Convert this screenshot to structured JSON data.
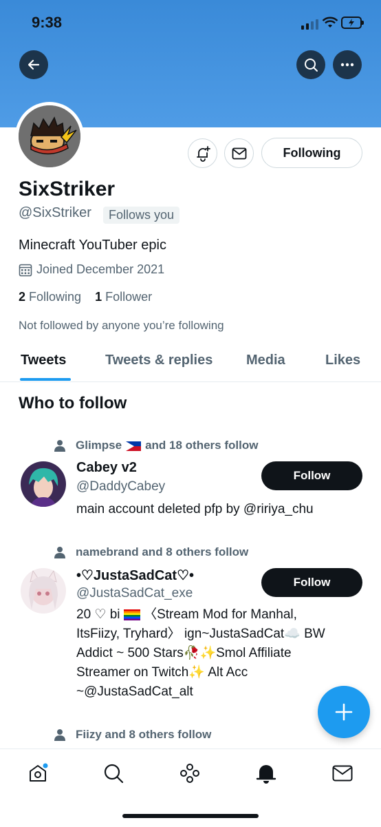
{
  "status_bar": {
    "time": "9:38"
  },
  "profile": {
    "name": "SixStriker",
    "handle": "@SixStriker",
    "follows_you": "Follows you",
    "bio": "Minecraft YouTuber epic",
    "joined": "Joined December 2021",
    "following_count": "2",
    "following_label": "Following",
    "follower_count": "1",
    "follower_label": "Follower",
    "not_followed": "Not followed by anyone you’re following",
    "following_button": "Following"
  },
  "tabs": [
    "Tweets",
    "Tweets & replies",
    "Media",
    "Likes"
  ],
  "who_to_follow": {
    "title": "Who to follow",
    "users": [
      {
        "social_context_pre": "Glimpse",
        "social_context_post": "and 18 others follow",
        "name": "Cabey v2",
        "handle": "@DaddyCabey",
        "bio": "main account deleted pfp by @ririya_chu",
        "button": "Follow"
      },
      {
        "social_context": "namebrand and 8 others follow",
        "name": "•♡JustaSadCat♡•",
        "handle": "@JustaSadCat_exe",
        "bio_line1_pre": "20 ♡ bi",
        "bio_line1_post": "〈Stream Mod for Manhal,",
        "bio_line2": "ItsFiizy, Tryhard〉 ign~JustaSadCat☁️ BW",
        "bio_line3": "Addict ~ 500 Stars🥀✨Smol Affiliate",
        "bio_line4": "Streamer on Twitch✨ Alt Acc",
        "bio_line5": "~@JustaSadCat_alt",
        "button": "Follow"
      },
      {
        "social_context": "Fiizy and 8 others follow"
      }
    ]
  },
  "colors": {
    "accent": "#1d9bf0",
    "banner": "#4a96e2",
    "text": "#0f1419",
    "muted": "#536471"
  }
}
